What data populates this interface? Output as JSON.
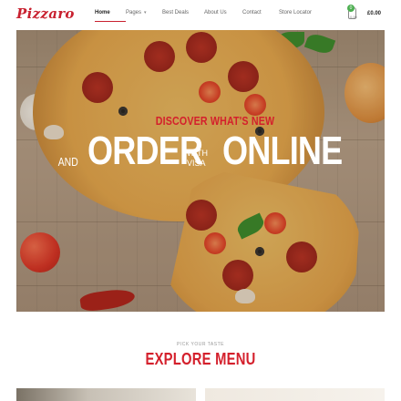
{
  "brand": {
    "logo_text": "Pizzaro",
    "accent_color": "#c8202f"
  },
  "nav": {
    "items": [
      {
        "label": "Home",
        "active": true
      },
      {
        "label": "Pages",
        "has_dropdown": true
      },
      {
        "label": "Best Deals"
      },
      {
        "label": "About Us"
      },
      {
        "label": "Contact"
      },
      {
        "label": "Store Locator"
      }
    ],
    "dropdown_icon": "chevron-down-icon"
  },
  "cart": {
    "count": "0",
    "sub_label": "0.00",
    "total": "£0.00",
    "icon": "cart-icon",
    "badge_color": "#4caf50"
  },
  "hero": {
    "subtitle": "DISCOVER WHAT'S NEW",
    "and_label": "AND",
    "order_label": "ORDER",
    "with_label": "WITH",
    "visa_label": "VISA",
    "online_label": "ONLINE"
  },
  "section": {
    "kicker": "PICK YOUR TASTE",
    "title": "EXPLORE MENU"
  }
}
